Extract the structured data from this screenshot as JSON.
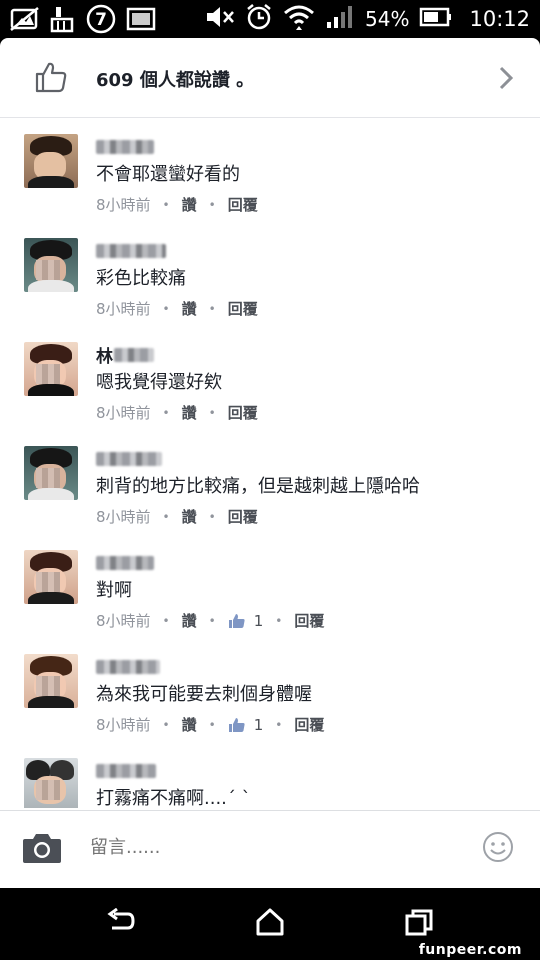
{
  "status_bar": {
    "battery_percent": "54%",
    "time": "10:12",
    "notification_badge": "7"
  },
  "likes": {
    "text": "609 個人都說讚 。"
  },
  "comments": [
    {
      "text": "不會耶還蠻好看的",
      "time": "8小時前",
      "like_label": "讚",
      "reply_label": "回覆",
      "like_count": ""
    },
    {
      "text": "彩色比較痛",
      "time": "8小時前",
      "like_label": "讚",
      "reply_label": "回覆",
      "like_count": ""
    },
    {
      "name_visible_char": "林",
      "text": "嗯我覺得還好欸",
      "time": "8小時前",
      "like_label": "讚",
      "reply_label": "回覆",
      "like_count": ""
    },
    {
      "text": "刺背的地方比較痛，但是越刺越上隱哈哈",
      "time": "8小時前",
      "like_label": "讚",
      "reply_label": "回覆",
      "like_count": ""
    },
    {
      "text": "對啊",
      "time": "8小時前",
      "like_label": "讚",
      "reply_label": "回覆",
      "like_count": "1"
    },
    {
      "text": "為來我可能要去刺個身體喔",
      "time": "8小時前",
      "like_label": "讚",
      "reply_label": "回覆",
      "like_count": "1"
    },
    {
      "text": "打霧痛不痛啊....´ `",
      "time": "",
      "like_label": "",
      "reply_label": "",
      "like_count": ""
    }
  ],
  "composer": {
    "placeholder": "留言......"
  },
  "watermark": "funpeer.com",
  "colors": {
    "text_primary": "#1d2129",
    "text_secondary": "#90949c",
    "facebook_blue": "#4267b2"
  }
}
